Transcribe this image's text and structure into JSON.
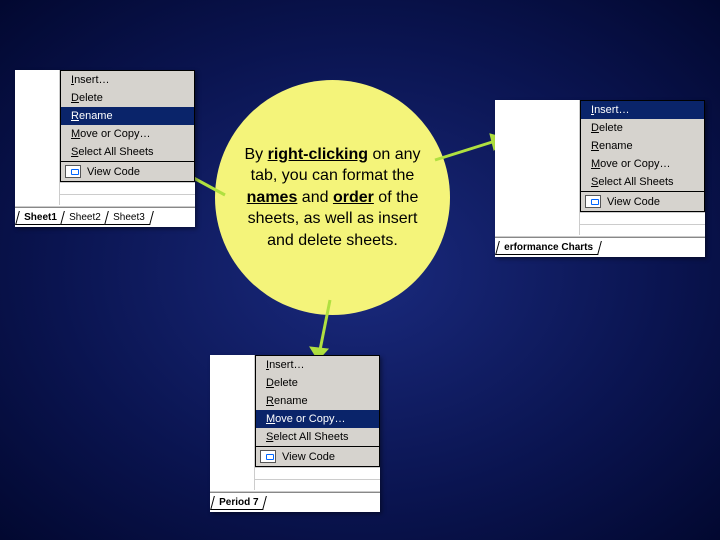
{
  "callout": {
    "prefix": "By ",
    "bold1": "right-clicking",
    "mid1": " on any tab, you can format the ",
    "bold2": "names",
    "mid2": " and ",
    "bold3": "order",
    "suffix": " of the sheets, as well as insert and delete sheets."
  },
  "menu": {
    "insert_pre": "",
    "insert_u": "I",
    "insert_post": "nsert…",
    "delete_pre": "",
    "delete_u": "D",
    "delete_post": "elete",
    "rename_pre": "",
    "rename_u": "R",
    "rename_post": "ename",
    "move_pre": "",
    "move_u": "M",
    "move_post": "ove or Copy…",
    "select_pre": "",
    "select_u": "S",
    "select_post": "elect All Sheets",
    "view_pre": "",
    "view_u": "V",
    "view_post": "iew Code"
  },
  "tabs1": {
    "a": "Sheet1",
    "b": "Sheet2",
    "c": "Sheet3"
  },
  "tabs2": {
    "a": "Period 7"
  },
  "tabs3": {
    "a": "erformance Charts"
  }
}
